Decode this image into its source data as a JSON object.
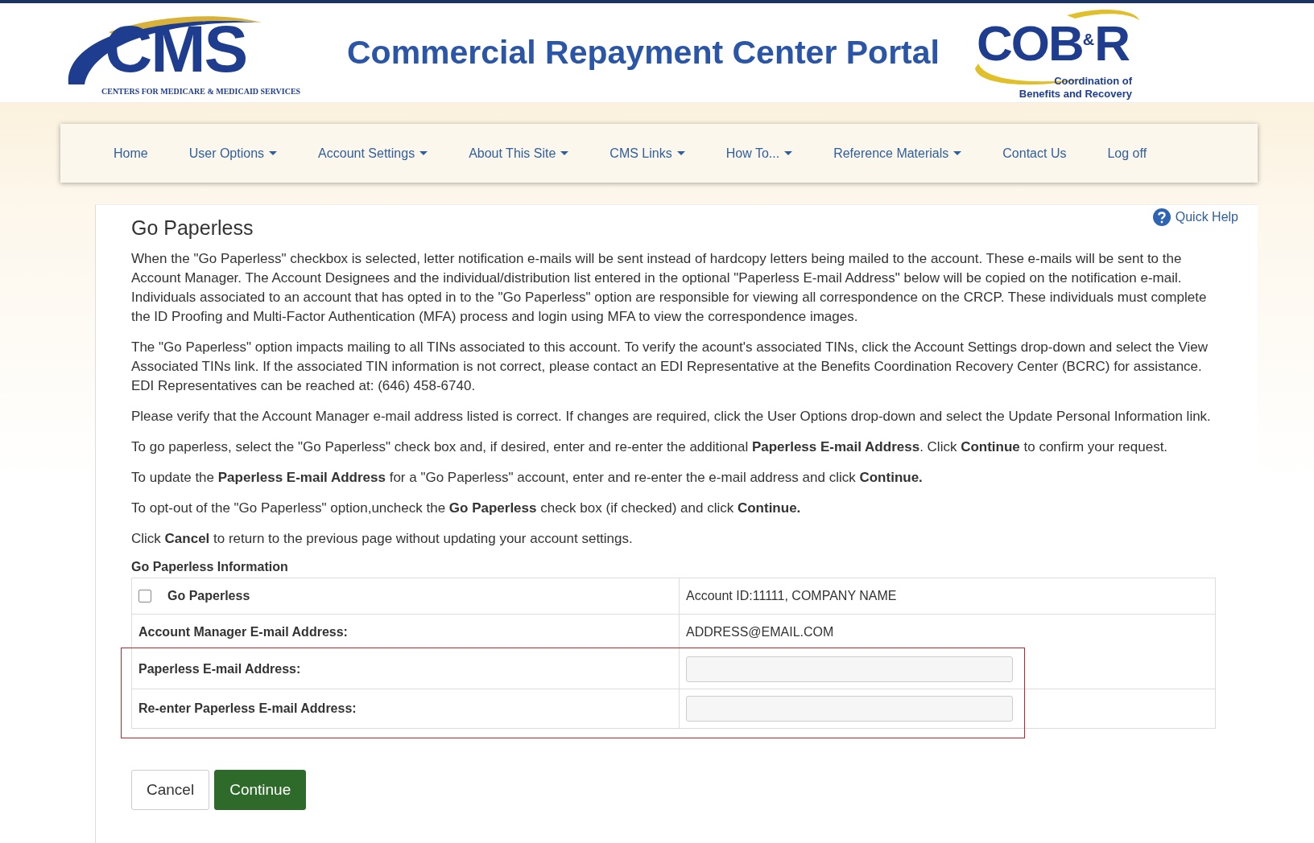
{
  "header": {
    "agency_logo": {
      "mark": "CMS",
      "caption": "CENTERS FOR MEDICARE & MEDICAID SERVICES"
    },
    "title": "Commercial Repayment Center Portal",
    "partner_logo": {
      "mark_left": "COB",
      "mark_amp": "&",
      "mark_right": "R",
      "caption_lines": [
        "Coordination of",
        "Benefits and Recovery"
      ]
    }
  },
  "nav": [
    {
      "label": "Home",
      "has_menu": false
    },
    {
      "label": "User Options",
      "has_menu": true
    },
    {
      "label": "Account Settings",
      "has_menu": true
    },
    {
      "label": "About This Site",
      "has_menu": true
    },
    {
      "label": "CMS Links",
      "has_menu": true
    },
    {
      "label": "How To...",
      "has_menu": true
    },
    {
      "label": "Reference Materials",
      "has_menu": true
    },
    {
      "label": "Contact Us",
      "has_menu": false
    },
    {
      "label": "Log off",
      "has_menu": false
    }
  ],
  "quick_help": "Quick Help",
  "page_title": "Go Paperless",
  "paragraphs": [
    "When the \"Go Paperless\" checkbox is selected, letter notification e-mails will be sent instead of hardcopy letters being mailed to the account. These e-mails will be sent to the Account Manager. The Account Designees and the individual/distribution list entered in the optional \"Paperless E-mail Address\" below will be copied on the notification e-mail. Individuals associated to an account that has opted in to the \"Go Paperless\" option are responsible for viewing all correspondence on the CRCP. These individuals must complete the ID Proofing and Multi-Factor Authentication (MFA) process and login using MFA to view the correspondence images.",
    "The \"Go Paperless\" option impacts mailing to all TINs associated to this account. To verify the acount's associated TINs, click the Account Settings drop-down and select the View Associated TINs link. If the associated TIN information is not correct, please contact an EDI Representative at the Benefits Coordination Recovery Center (BCRC) for assistance. EDI Representatives can be reached at: (646) 458-6740.",
    "Please verify that the Account Manager e-mail address listed is correct. If changes are required, click the User Options drop-down and select the Update Personal Information link.",
    "To go paperless, select the \"Go Paperless\" check box and, if desired, enter and re-enter the additional **Paperless E-mail Address**. Click **Continue** to confirm your request.",
    "To update the **Paperless E-mail Address** for a \"Go Paperless\" account, enter and re-enter the e-mail address and click **Continue.**",
    "To opt-out of the \"Go Paperless\" option,uncheck the **Go Paperless** check box (if checked) and click **Continue.**",
    "Click **Cancel** to return to the previous page without updating your account settings."
  ],
  "section_title": "Go Paperless Information",
  "rows": [
    {
      "kind": "checkbox",
      "label": "Go Paperless",
      "checked": false,
      "highlighted": false,
      "value": "Account ID:11111, COMPANY NAME"
    },
    {
      "kind": "text",
      "label": "Account Manager E-mail Address:",
      "highlighted": false,
      "value": "ADDRESS@EMAIL.COM"
    },
    {
      "kind": "input",
      "label": "Paperless E-mail Address:",
      "highlighted": true
    },
    {
      "kind": "input",
      "label": "Re-enter Paperless E-mail Address:",
      "highlighted": true
    }
  ],
  "buttons": [
    {
      "label": "Cancel",
      "kind": "default"
    },
    {
      "label": "Continue",
      "kind": "primary"
    }
  ]
}
